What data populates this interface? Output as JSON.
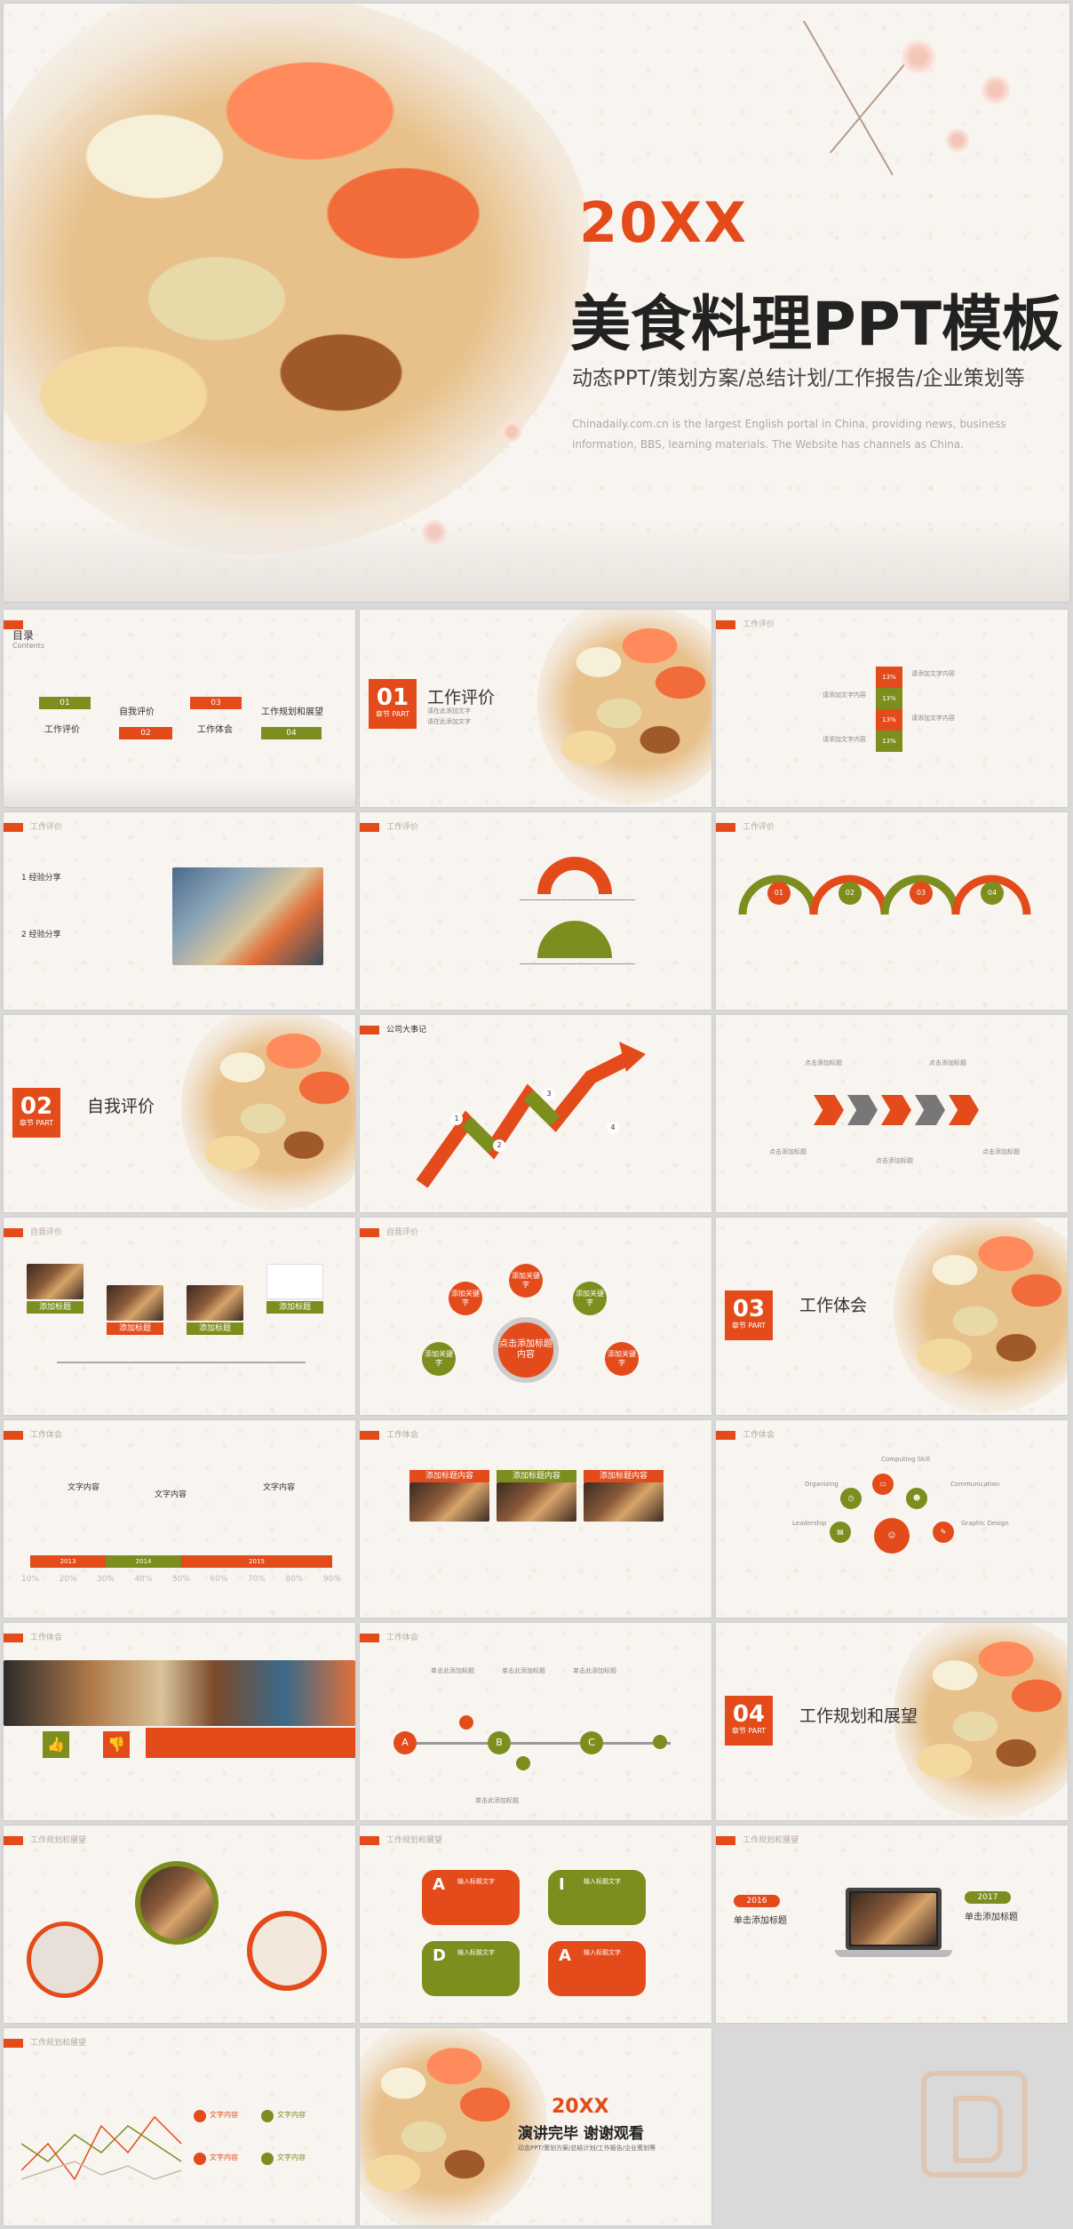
{
  "cover": {
    "year": "20XX",
    "title": "美食料理PPT模板",
    "subtitle": "动态PPT/策划方案/总结计划/工作报告/企业策划等",
    "desc": "Chinadaily.com.cn is the largest English portal in China, providing news, business information, BBS, learning materials. The Website has channels as China."
  },
  "s2": {
    "title": "目录",
    "sub": "Contents",
    "items": [
      {
        "num": "01",
        "label": "工作评价"
      },
      {
        "num": "02",
        "label": "自我评价"
      },
      {
        "num": "03",
        "label": "工作体会"
      },
      {
        "num": "04",
        "label": "工作规划和展望"
      }
    ]
  },
  "s3": {
    "num": "01",
    "part": "章节 PART",
    "title": "工作评价",
    "bullets": [
      "请在此添加文字",
      "请在此添加文字"
    ]
  },
  "s4": {
    "tag": "工作评价",
    "pct": "13%",
    "text": "请添加文字内容"
  },
  "s5": {
    "tag": "工作评价",
    "p1": "经验分享",
    "p2": "经验分享",
    "n1": "1",
    "n2": "2"
  },
  "s6": {
    "tag": "工作评价"
  },
  "s7": {
    "tag": "工作评价",
    "nums": [
      "01",
      "02",
      "03",
      "04"
    ]
  },
  "s8": {
    "num": "02",
    "part": "章节 PART",
    "title": "自我评价"
  },
  "s9": {
    "tag": "公司大事记",
    "nums": [
      "1",
      "2",
      "3",
      "4"
    ]
  },
  "s10": {
    "tag": "",
    "label": "点击添加标题"
  },
  "s11": {
    "tag": "自我评价",
    "labels": [
      "添加标题",
      "添加标题",
      "添加标题",
      "添加标题"
    ]
  },
  "s12": {
    "tag": "自我评价",
    "center": "点击添加标题内容",
    "keys": [
      "添加关键字",
      "添加关键字",
      "添加关键字",
      "添加关键字",
      "添加关键字"
    ]
  },
  "s13": {
    "num": "03",
    "part": "章节 PART",
    "title": "工作体会"
  },
  "s14": {
    "tag": "工作体会",
    "items": [
      "文字内容",
      "文字内容",
      "文字内容"
    ],
    "years": [
      "2013",
      "2014",
      "2015"
    ],
    "ticks": [
      "10%",
      "20%",
      "30%",
      "40%",
      "50%",
      "60%",
      "70%",
      "80%",
      "90%"
    ]
  },
  "s15": {
    "tag": "工作体会",
    "heads": [
      "添加标题内容",
      "添加标题内容",
      "添加标题内容"
    ]
  },
  "s16": {
    "tag": "工作体会",
    "labels": [
      "Computing Skill",
      "Organizing",
      "Communication",
      "Leadership",
      "Graphic Design"
    ]
  },
  "s17": {
    "tag": "工作体会"
  },
  "s18": {
    "tag": "工作体会",
    "letters": [
      "A",
      "B",
      "C"
    ],
    "label": "单击此添加标题"
  },
  "s19": {
    "num": "04",
    "part": "章节 PART",
    "title": "工作规划和展望"
  },
  "s20": {
    "tag": "工作规划和展望"
  },
  "s21": {
    "tag": "工作规划和展望",
    "letters": [
      "A",
      "I",
      "D",
      "A"
    ],
    "label": "输入标题文字"
  },
  "s22": {
    "tag": "工作规划和展望",
    "y1": "2016",
    "y2": "2017",
    "t1": "单击添加标题",
    "t2": "单击添加标题"
  },
  "s23": {
    "tag": "工作规划和展望",
    "items": [
      "文字内容",
      "文字内容",
      "文字内容",
      "文字内容"
    ]
  },
  "s24": {
    "year": "20XX",
    "title": "演讲完毕 谢谢观看",
    "sub": "动态PPT/策划方案/总结计划/工作报告/企业策划等"
  },
  "colors": {
    "accent": "#e34b1b",
    "green": "#7c8e1e"
  }
}
